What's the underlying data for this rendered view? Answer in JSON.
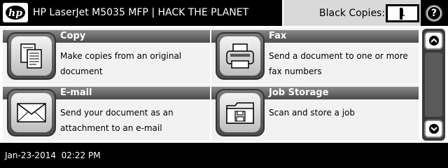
{
  "header": {
    "logo_text": "hp",
    "device_title": "HP LaserJet M5035 MFP | HACK THE PLANET",
    "copies_label": "Black Copies:",
    "copies_value": "1",
    "help_label": "?"
  },
  "tiles": [
    {
      "title": "Copy",
      "description": "Make copies from an original document",
      "icon": "copy-icon"
    },
    {
      "title": "Fax",
      "description": "Send a document to one or more fax numbers",
      "icon": "fax-icon"
    },
    {
      "title": "E-mail",
      "description": "Send your document as an attachment to an e-mail",
      "icon": "email-icon"
    },
    {
      "title": "Job Storage",
      "description": "Scan and store a job",
      "icon": "job-storage-icon"
    }
  ],
  "scrollbar": {
    "up_icon": "chevron-up-icon",
    "down_icon": "chevron-down-icon"
  },
  "status": {
    "datetime": "Jan-23-2014  02:22 PM"
  },
  "colors": {
    "bar": "#000000",
    "tile_header": "#6a6a6a",
    "tile_bg": "#f2f2f2",
    "panel": "#d9d9d9"
  }
}
